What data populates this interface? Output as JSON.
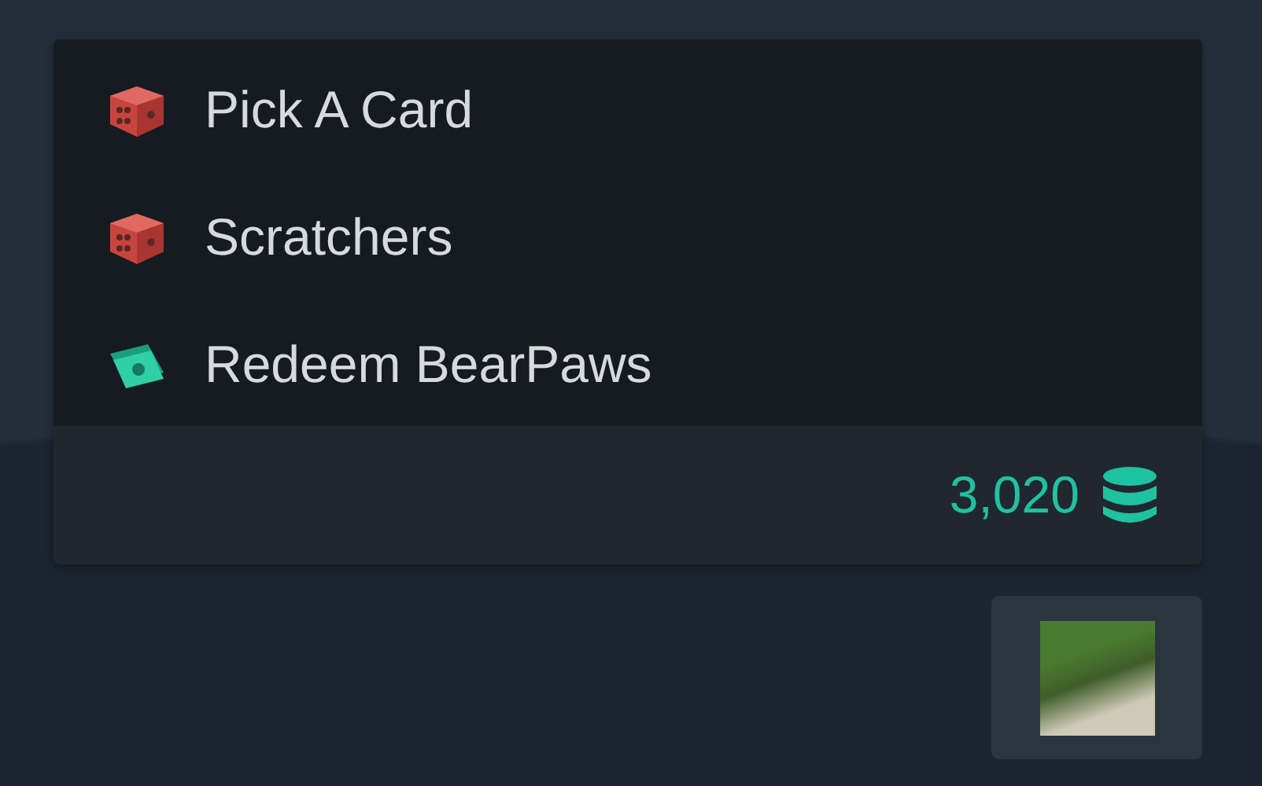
{
  "menu": {
    "items": [
      {
        "label": "Pick A Card",
        "kind": "dice"
      },
      {
        "label": "Scratchers",
        "kind": "dice"
      },
      {
        "label": "Redeem BearPaws",
        "kind": "cash"
      }
    ]
  },
  "balance": {
    "amount": "3,020"
  }
}
